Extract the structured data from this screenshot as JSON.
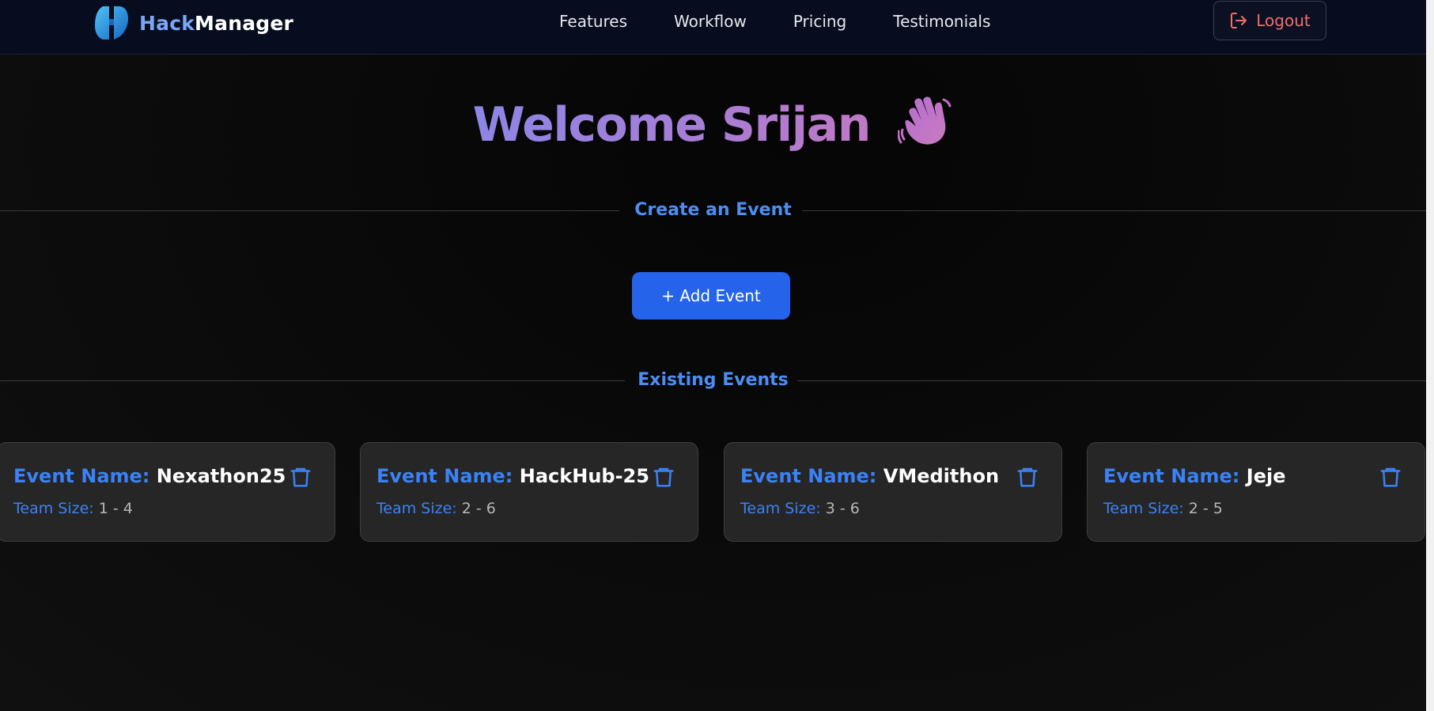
{
  "header": {
    "brand": {
      "part1": "Hack",
      "part2": "Manager"
    },
    "nav": [
      "Features",
      "Workflow",
      "Pricing",
      "Testimonials"
    ],
    "logout_label": "Logout"
  },
  "welcome": {
    "text": "Welcome Srijan",
    "emoji_icon": "waving-hand-icon"
  },
  "create_section": {
    "title": "Create an Event",
    "add_button_label": "+ Add Event"
  },
  "events_section": {
    "title": "Existing Events",
    "name_label": "Event Name:",
    "team_label": "Team Size:",
    "events": [
      {
        "name": "Nexathon25",
        "team_size": "1 - 4"
      },
      {
        "name": "HackHub-25",
        "team_size": "2 - 6"
      },
      {
        "name": "VMedithon",
        "team_size": "3 - 6"
      },
      {
        "name": "Jeje",
        "team_size": "2 - 5"
      }
    ]
  },
  "colors": {
    "accent_blue": "#3b82f6",
    "button_blue": "#2563eb",
    "logout_red": "#f26d6d",
    "nav_bg": "#070d1e",
    "card_bg": "#262626"
  }
}
